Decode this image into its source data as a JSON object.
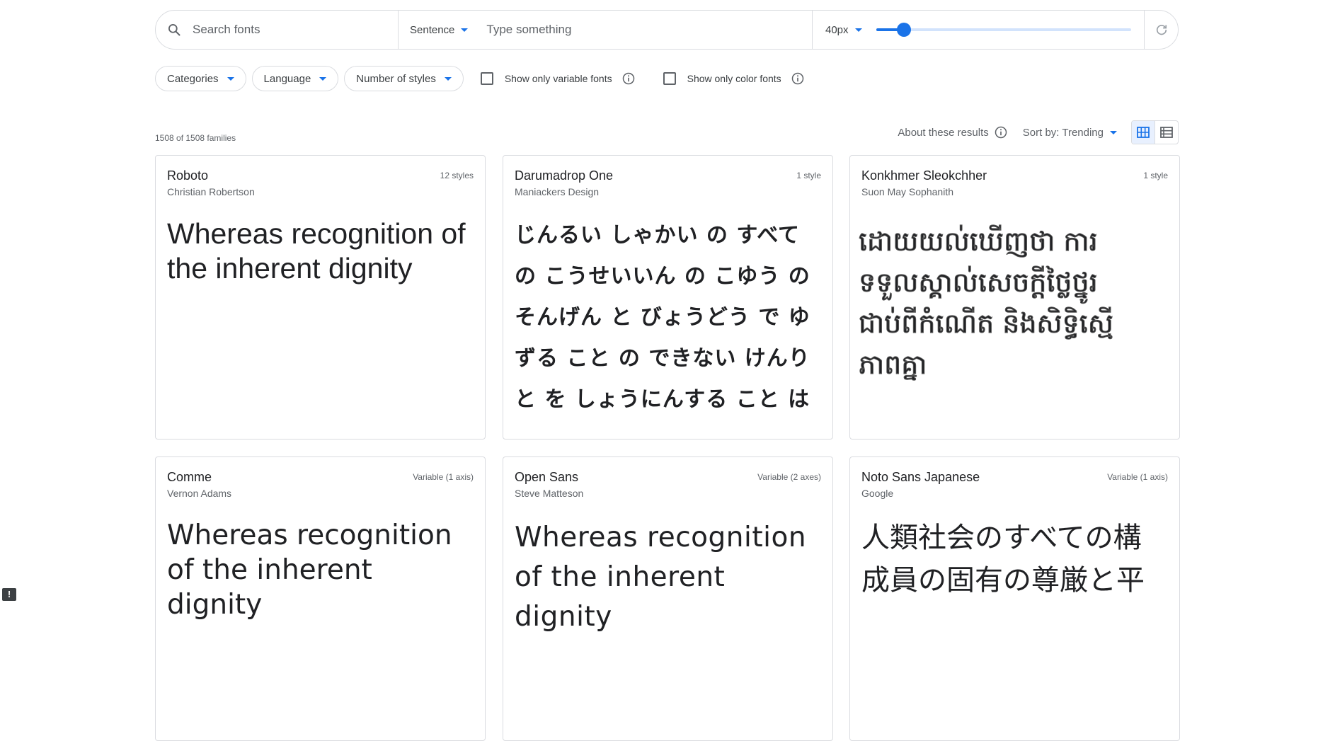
{
  "toolbar": {
    "search_placeholder": "Search fonts",
    "preview_mode": "Sentence",
    "preview_placeholder": "Type something",
    "font_size": "40px",
    "size_slider_fraction": 0.11
  },
  "filters": {
    "categories": "Categories",
    "language": "Language",
    "number_of_styles": "Number of styles",
    "variable_label": "Show only variable fonts",
    "color_label": "Show only color fonts"
  },
  "results": {
    "count": "1508 of 1508 families",
    "about": "About these results",
    "sort": "Sort by: Trending"
  },
  "cards": [
    {
      "name": "Roboto",
      "designer": "Christian Robertson",
      "styles": "12 styles",
      "sample": "Whereas recognition of the inherent dignity"
    },
    {
      "name": "Darumadrop One",
      "designer": "Maniackers Design",
      "styles": "1 style",
      "sample": "じんるい しゃかい の すべて の こうせいいん の こゆう の そんげん と びょうどう で ゆずる こと の できない けんり と を しょうにんする こと は"
    },
    {
      "name": "Konkhmer Sleokchher",
      "designer": "Suon May Sophanith",
      "styles": "1 style",
      "sample": "ដោយយល់ឃើញថា ការទទួលស្គាល់សេចក្តីថ្លៃថ្នូរជាប់ពីកំណើត និងសិទ្ធិស្មើភាពគ្នា"
    },
    {
      "name": "Comme",
      "designer": "Vernon Adams",
      "styles": "Variable (1 axis)",
      "sample": "Whereas recognition of the inherent dignity"
    },
    {
      "name": "Open Sans",
      "designer": "Steve Matteson",
      "styles": "Variable (2 axes)",
      "sample": "Whereas recognition of the inherent dignity"
    },
    {
      "name": "Noto Sans Japanese",
      "designer": "Google",
      "styles": "Variable (1 axis)",
      "sample": "人類社会のすべての構成員の固有の尊厳と平"
    }
  ],
  "colors": {
    "accent": "#1a73e8",
    "border": "#dadce0",
    "text_primary": "#202124",
    "text_secondary": "#5f6368"
  },
  "icons": {
    "search": "search-icon",
    "reset": "refresh-icon",
    "info": "info-icon",
    "grid_view": "grid-view-icon",
    "list_view": "list-view-icon",
    "feedback": "feedback-icon"
  }
}
